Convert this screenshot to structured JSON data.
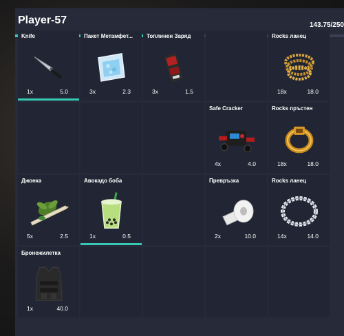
{
  "player": {
    "name": "Player-57",
    "weight_text": "143.75/250",
    "weight_fraction": 0.575
  },
  "colors": {
    "accent": "#36c9b5",
    "panel": "#272b39",
    "slot": "#222634"
  },
  "slots": [
    {
      "name": "Knife",
      "qty": "1x",
      "weight": "5.0",
      "icon": "knife-icon",
      "durability": 1
    },
    {
      "name": "Пакет Метамфет...",
      "qty": "3x",
      "weight": "2.3",
      "icon": "meth-bag-icon"
    },
    {
      "name": "Топлинен Заряд",
      "qty": "3x",
      "weight": "1.5",
      "icon": "thermal-charge-icon"
    },
    {},
    {
      "name": "Rocks ланец",
      "qty": "18x",
      "weight": "18.0",
      "icon": "gold-chain-icon"
    },
    {},
    {},
    {},
    {
      "name": "Safe Cracker",
      "qty": "4x",
      "weight": "4.0",
      "icon": "safe-cracker-icon"
    },
    {
      "name": "Rocks пръстен",
      "qty": "18x",
      "weight": "18.0",
      "icon": "gold-ring-icon"
    },
    {
      "name": "Джонка",
      "qty": "5x",
      "weight": "2.5",
      "icon": "joint-icon"
    },
    {
      "name": "Авокадо боба",
      "qty": "1x",
      "weight": "0.5",
      "icon": "boba-drink-icon",
      "durability": 1
    },
    {},
    {
      "name": "Превръзка",
      "qty": "2x",
      "weight": "10.0",
      "icon": "bandage-icon"
    },
    {
      "name": "Rocks ланец",
      "qty": "14x",
      "weight": "14.0",
      "icon": "diamond-chain-icon"
    },
    {
      "name": "Бронежилетка",
      "qty": "1x",
      "weight": "40.0",
      "icon": "body-armor-icon"
    },
    {},
    {},
    {},
    {}
  ]
}
